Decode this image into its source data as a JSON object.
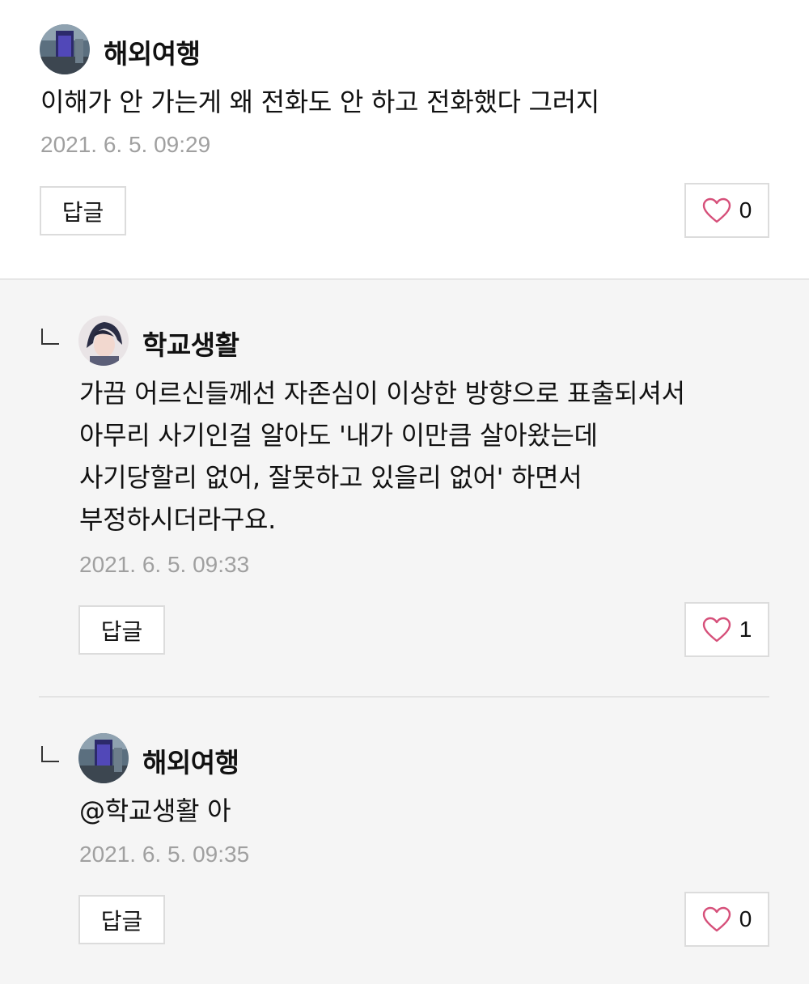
{
  "comments": [
    {
      "author": "해외여행",
      "text": "이해가 안 가는게 왜 전화도 안 하고 전화했다 그러지",
      "timestamp": "2021. 6. 5. 09:29",
      "reply_label": "답글",
      "likes": "0"
    }
  ],
  "replies": [
    {
      "author": "학교생활",
      "text": "가끔 어르신들께선 자존심이 이상한 방향으로 표출되셔서\n아무리 사기인걸 알아도 '내가 이만큼 살아왔는데\n사기당할리 없어, 잘못하고 있을리 없어' 하면서\n부정하시더라구요.",
      "timestamp": "2021. 6. 5. 09:33",
      "reply_label": "답글",
      "likes": "1"
    },
    {
      "author": "해외여행",
      "mention": "@학교생활",
      "text": " 아",
      "timestamp": "2021. 6. 5. 09:35",
      "reply_label": "답글",
      "likes": "0"
    }
  ],
  "icons": {
    "heart": "heart-outline-icon",
    "heart_color": "#d6507a",
    "reply_marker": "reply-corner-icon"
  }
}
